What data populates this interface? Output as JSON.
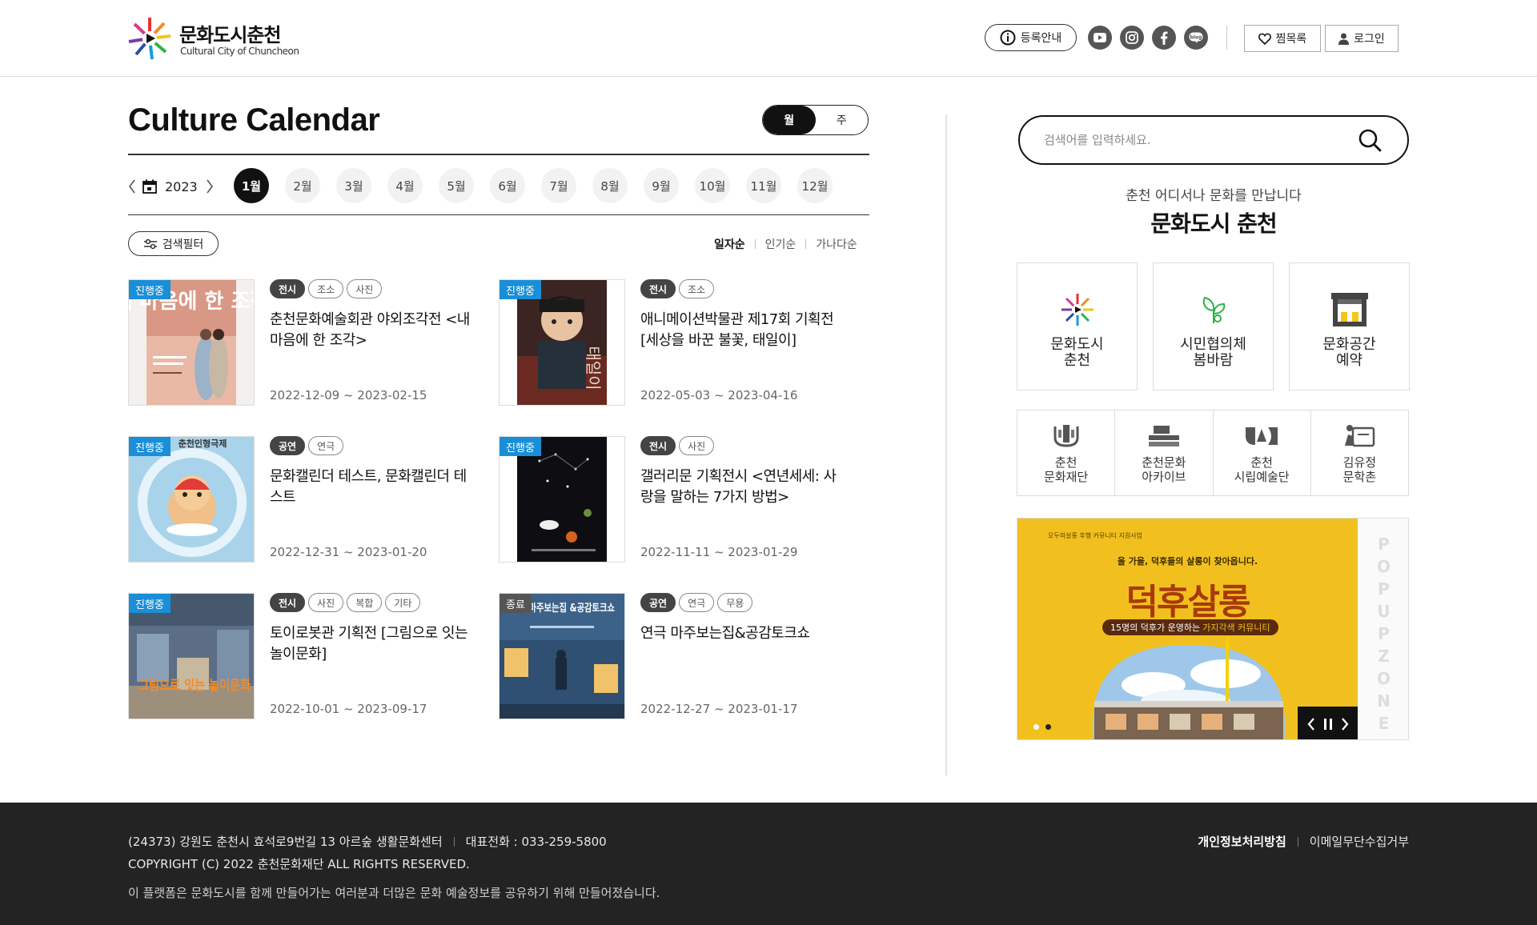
{
  "header": {
    "logo_title": "문화도시춘천",
    "logo_sub": "Cultural City of Chuncheon",
    "guide_label": "등록안내",
    "social": [
      {
        "icon": "youtube-icon"
      },
      {
        "icon": "instagram-icon"
      },
      {
        "icon": "facebook-icon"
      },
      {
        "icon": "blog-icon"
      }
    ],
    "wishlist_label": "찜목록",
    "login_label": "로그인"
  },
  "calendar": {
    "title": "Culture Calendar",
    "view_month": "월",
    "view_week": "주",
    "year": "2023",
    "months": [
      "1월",
      "2월",
      "3월",
      "4월",
      "5월",
      "6월",
      "7월",
      "8월",
      "9월",
      "10월",
      "11월",
      "12월"
    ],
    "active_month": "1월",
    "filter_label": "검색필터",
    "sort": [
      "일자순",
      "인기순",
      "가나다순"
    ]
  },
  "events": [
    {
      "status": "진행중",
      "tags": [
        "전시",
        "조소",
        "사진"
      ],
      "title": "춘천문화예술회관 야외조각전 <내 마음에 한 조각>",
      "date": "2022-12-09 ~ 2023-02-15",
      "poster_text": "내 마음에 한 조각"
    },
    {
      "status": "진행중",
      "tags": [
        "전시",
        "조소"
      ],
      "title": "애니메이션박물관 제17회 기획전 [세상을 바꾼 불꽃, 태일이]",
      "date": "2022-05-03 ~ 2023-04-16",
      "poster_text": "태일이"
    },
    {
      "status": "진행중",
      "tags": [
        "공연",
        "연극"
      ],
      "title": "문화캘린더 테스트, 문화캘린더 테스트",
      "date": "2022-12-31 ~ 2023-01-20",
      "poster_text": "춘천인형극제"
    },
    {
      "status": "진행중",
      "tags": [
        "전시",
        "사진"
      ],
      "title": "갤러리문 기획전시 <연년세세: 사랑을 말하는 7가지 방법>",
      "date": "2022-11-11 ~ 2023-01-29",
      "poster_text": ""
    },
    {
      "status": "진행중",
      "tags": [
        "전시",
        "사진",
        "복합",
        "기타"
      ],
      "title": "토이로봇관 기획전 [그림으로 잇는 놀이문화]",
      "date": "2022-10-01 ~ 2023-09-17",
      "poster_text": "그림으로 잇는 놀이문화"
    },
    {
      "status": "종료",
      "tags": [
        "공연",
        "연극",
        "무용"
      ],
      "title": "연극 마주보는집&공감토크쇼",
      "date": "2022-12-27 ~ 2023-01-17",
      "poster_text": "연극 마주보는집 &공감토크쇼"
    }
  ],
  "sidebar": {
    "search_placeholder": "검색어를 입력하세요.",
    "slogan_sub": "춘천 어디서나 문화를 만납니다",
    "slogan_main": "문화도시 춘천",
    "big_links": [
      {
        "label": "문화도시\n춘천",
        "icon": "culture-city-logo-icon"
      },
      {
        "label": "시민협의체\n봄바람",
        "icon": "sprout-icon"
      },
      {
        "label": "문화공간\n예약",
        "icon": "stage-icon"
      }
    ],
    "small_links": [
      {
        "label": "춘천\n문화재단",
        "icon": "foundation-icon"
      },
      {
        "label": "춘천문화\n아카이브",
        "icon": "archive-icon"
      },
      {
        "label": "춘천\n시립예술단",
        "icon": "art-troupe-icon"
      },
      {
        "label": "김유정\n문학촌",
        "icon": "literature-village-icon"
      }
    ],
    "popup": {
      "banner_top": "오두의살롱 후행 커뮤니티 지원사업",
      "banner_sub": "올 가을, 덕후들의 살롱이 찾아옵니다.",
      "banner_title": "덕후살롱",
      "banner_pill": "15명의 덕후가 운영하는",
      "banner_pill_hl": "가지각색 커뮤니티",
      "vertical_text": [
        "P",
        "O",
        "P",
        "U",
        "P",
        "Z",
        "O",
        "N",
        "E"
      ]
    }
  },
  "footer": {
    "address": "(24373) 강원도 춘천시 효석로9번길 13 아르숲 생활문화센터",
    "phone": "대표전화 : 033-259-5800",
    "copyright": "COPYRIGHT (C) 2022 춘천문화재단 ALL RIGHTS RESERVED.",
    "note": "이 플랫폼은 문화도시를 함께 만들어가는 여러분과 더많은 문화 예술정보를 공유하기 위해 만들어졌습니다.",
    "privacy": "개인정보처리방침",
    "email_policy": "이메일무단수집거부"
  }
}
